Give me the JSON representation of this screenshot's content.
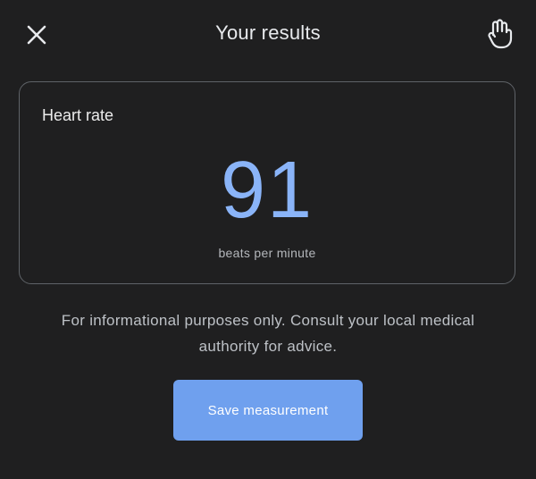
{
  "header": {
    "title": "Your results",
    "close_icon": "close-icon",
    "hand_icon": "pointing-hand-icon"
  },
  "card": {
    "label": "Heart rate",
    "value": "91",
    "unit": "beats per minute",
    "value_color": "#8ab4f8"
  },
  "disclaimer": "For informational purposes only. Consult your local medical authority for advice.",
  "actions": {
    "save_label": "Save measurement",
    "save_color": "#6fa0ee"
  }
}
